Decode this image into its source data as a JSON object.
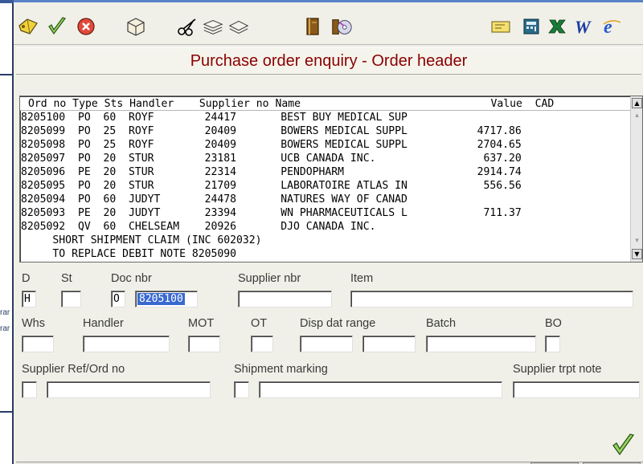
{
  "window": {
    "title": "Purchase order enquiry - Order header"
  },
  "left_panel": {
    "fragments": [
      "rar",
      "rar"
    ]
  },
  "toolbar": {
    "left_icons": [
      "folder-back-icon",
      "check-icon",
      "cancel-icon",
      "box-icon",
      "scissors-icon",
      "stack-icon",
      "stack-flat-icon",
      "book-icon",
      "cd-icon"
    ],
    "right_icons": [
      "note-icon",
      "calculator-icon",
      "excel-icon",
      "word-icon",
      "ie-icon"
    ]
  },
  "list": {
    "header": "Ord no Type Sts Handler    Supplier no Name                              Value  CAD",
    "rows": [
      "8205100  PO  60  ROYF        24417       BEST BUY MEDICAL SUP",
      "8205099  PO  25  ROYF        20409       BOWERS MEDICAL SUPPL           4717.86",
      "8205098  PO  25  ROYF        20409       BOWERS MEDICAL SUPPL           2704.65",
      "8205097  PO  20  STUR        23181       UCB CANADA INC.                 637.20",
      "8205096  PE  20  STUR        22314       PENDOPHARM                     2914.74",
      "8205095  PO  20  STUR        21709       LABORATOIRE ATLAS IN            556.56",
      "8205094  PO  60  JUDYT       24478       NATURES WAY OF CANAD",
      "8205093  PE  20  JUDYT       23394       WN PHARMACEUTICALS L            711.37",
      "8205092  QV  60  CHELSEAM    20926       DJO CANADA INC.",
      "     SHORT SHIPMENT CLAIM (INC 602032)",
      "     TO REPLACE DEBIT NOTE 8205090"
    ]
  },
  "form": {
    "labels": {
      "d": "D",
      "st": "St",
      "doc_nbr": "Doc nbr",
      "supplier_nbr": "Supplier nbr",
      "item": "Item",
      "whs": "Whs",
      "handler": "Handler",
      "mot": "MOT",
      "ot": "OT",
      "disp_dat_range": "Disp dat range",
      "batch": "Batch",
      "bo": "BO",
      "supplier_ref": "Supplier Ref/Ord no",
      "shipment_marking": "Shipment marking",
      "supplier_trpt_note": "Supplier trpt note"
    },
    "values": {
      "d": "H",
      "st": "",
      "doc_type": "O",
      "doc_nbr": "8205100"
    }
  }
}
